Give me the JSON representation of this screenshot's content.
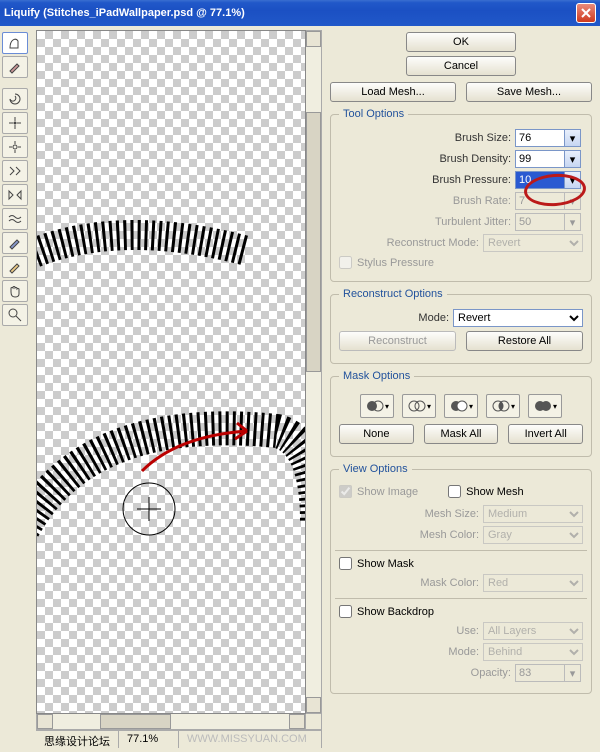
{
  "title": "Liquify (Stitches_iPadWallpaper.psd @ 77.1%)",
  "buttons": {
    "ok": "OK",
    "cancel": "Cancel",
    "load_mesh": "Load Mesh...",
    "save_mesh": "Save Mesh...",
    "reconstruct": "Reconstruct",
    "restore_all": "Restore All",
    "none": "None",
    "mask_all": "Mask All",
    "invert_all": "Invert All"
  },
  "tool_options": {
    "legend": "Tool Options",
    "brush_size_label": "Brush Size:",
    "brush_size": "76",
    "brush_density_label": "Brush Density:",
    "brush_density": "99",
    "brush_pressure_label": "Brush Pressure:",
    "brush_pressure": "10",
    "brush_rate_label": "Brush Rate:",
    "brush_rate": "7",
    "turbulent_jitter_label": "Turbulent Jitter:",
    "turbulent_jitter": "50",
    "reconstruct_mode_label": "Reconstruct Mode:",
    "reconstruct_mode": "Revert",
    "stylus_pressure": "Stylus Pressure"
  },
  "reconstruct_options": {
    "legend": "Reconstruct Options",
    "mode_label": "Mode:",
    "mode": "Revert"
  },
  "mask_options": {
    "legend": "Mask Options"
  },
  "view_options": {
    "legend": "View Options",
    "show_image": "Show Image",
    "show_mesh": "Show Mesh",
    "mesh_size_label": "Mesh Size:",
    "mesh_size": "Medium",
    "mesh_color_label": "Mesh Color:",
    "mesh_color": "Gray",
    "show_mask": "Show Mask",
    "mask_color_label": "Mask Color:",
    "mask_color": "Red",
    "show_backdrop": "Show Backdrop",
    "use_label": "Use:",
    "use": "All Layers",
    "mode_label2": "Mode:",
    "mode2": "Behind",
    "opacity_label": "Opacity:",
    "opacity": "83"
  },
  "status": {
    "label1": "思缘设计论坛",
    "zoom": "77.1%",
    "watermark": "WWW.MISSYUAN.COM"
  }
}
